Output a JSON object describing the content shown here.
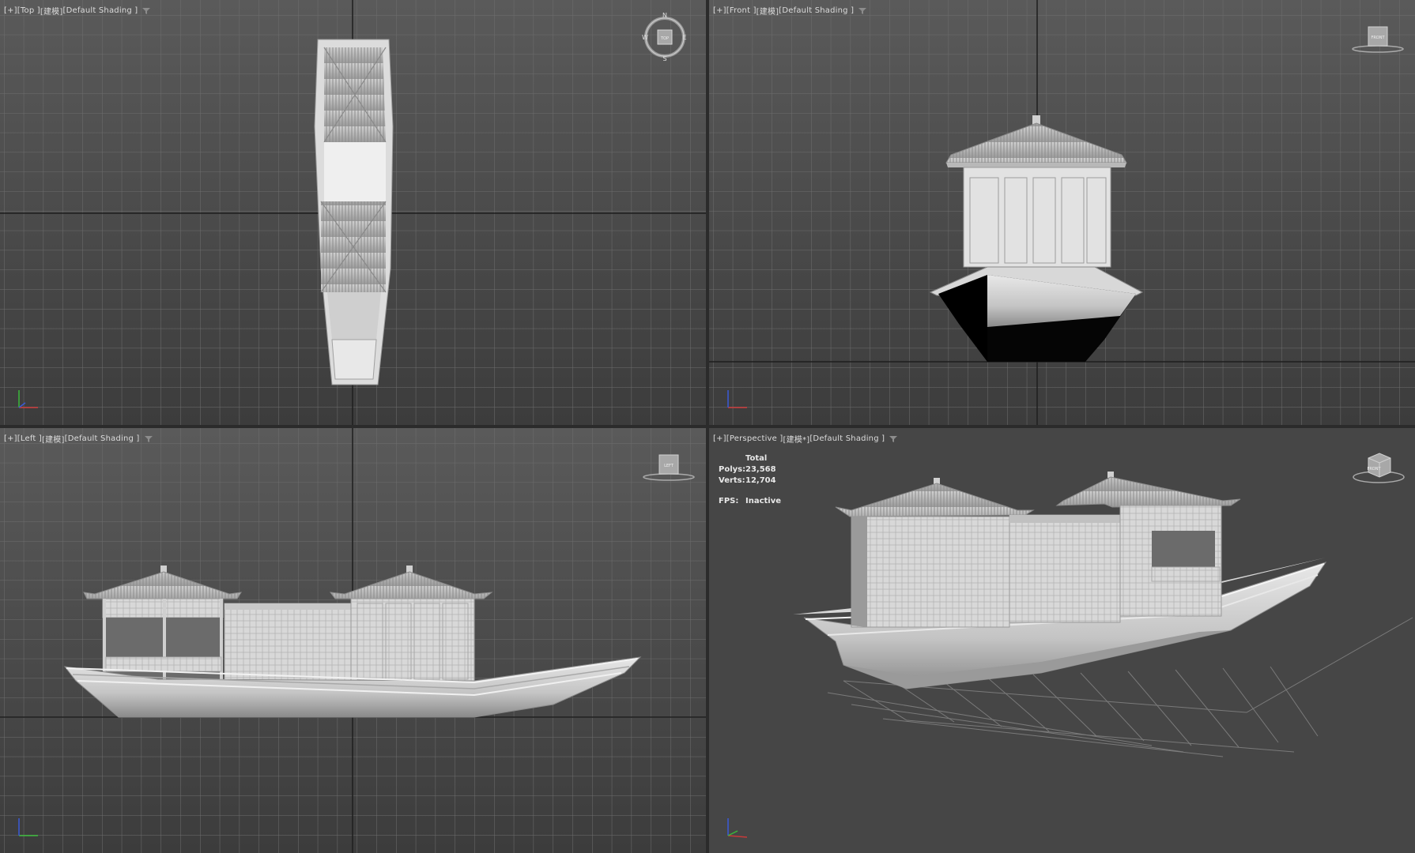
{
  "viewports": {
    "top": {
      "labels": [
        "[+]",
        "[Top ]",
        "[建模]",
        "[Default Shading ]"
      ],
      "compass": {
        "n": "N",
        "s": "S",
        "e": "E",
        "w": "W",
        "cube_face": "TOP"
      }
    },
    "front": {
      "labels": [
        "[+]",
        "[Front ]",
        "[建模]",
        "[Default Shading ]"
      ],
      "cube_face": "FRONT"
    },
    "left": {
      "labels": [
        "[+]",
        "[Left ]",
        "[建模]",
        "[Default Shading ]"
      ],
      "cube_face": "LEFT"
    },
    "perspective": {
      "labels": [
        "[+]",
        "[Perspective ]",
        "[建模*]",
        "[Default Shading ]"
      ],
      "cube_face": "FRONT",
      "stats": {
        "header": "Total",
        "polys_label": "Polys:",
        "polys_value": "23,568",
        "verts_label": "Verts:",
        "verts_value": "12,704",
        "fps_label": "FPS:",
        "fps_value": "Inactive"
      },
      "active": true
    }
  },
  "colors": {
    "active_border": "#b8a14a",
    "axis_x": "#c83a3a",
    "axis_y": "#3ab83a",
    "axis_z": "#3a5ad8"
  },
  "icons": [
    "filter-icon",
    "viewcube-icon",
    "compass-icon",
    "axis-tripod-icon"
  ]
}
